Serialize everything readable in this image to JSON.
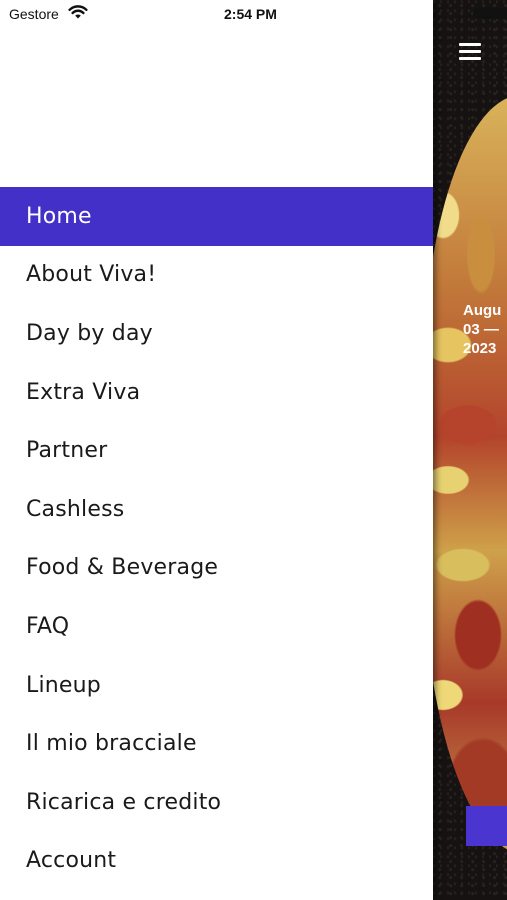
{
  "status_bar": {
    "carrier": "Gestore",
    "time": "2:54 PM",
    "wifi_icon": "wifi-icon"
  },
  "drawer": {
    "accent_color": "#4330c8",
    "menu": [
      {
        "label": "Home",
        "active": true
      },
      {
        "label": "About Viva!",
        "active": false
      },
      {
        "label": "Day by day",
        "active": false
      },
      {
        "label": "Extra Viva",
        "active": false
      },
      {
        "label": "Partner",
        "active": false
      },
      {
        "label": "Cashless",
        "active": false
      },
      {
        "label": "Food & Beverage",
        "active": false
      },
      {
        "label": "FAQ",
        "active": false
      },
      {
        "label": "Lineup",
        "active": false
      },
      {
        "label": "Il mio bracciale",
        "active": false
      },
      {
        "label": "Ricarica e credito",
        "active": false
      },
      {
        "label": "Account",
        "active": false
      }
    ]
  },
  "background_app": {
    "menu_icon": "hamburger-menu-icon",
    "date_lines": [
      "Augu",
      "03 —",
      "2023"
    ],
    "button_color": "#4a35d0"
  }
}
